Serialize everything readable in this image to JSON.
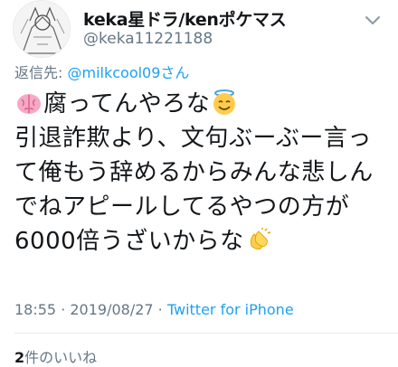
{
  "user": {
    "display_name": "keka星ドラ/kenポケマス",
    "handle": "@keka11221188"
  },
  "reply": {
    "prefix": "返信先: ",
    "target": "@milkcool09さん"
  },
  "tweet": {
    "line1_text": "腐ってんやろな",
    "line2": "引退詐欺より、文句ぶーぶー言っ",
    "line3": "て俺もう辞めるからみんな悲しん",
    "line4": "でねアピールしてるやつの方が",
    "line5_text": "6000倍うざいからな",
    "emojis": [
      "brain-emoji",
      "smiling-face-with-halo-emoji",
      "clapping-hands-emoji"
    ]
  },
  "meta": {
    "time": "18:55",
    "sep1": " · ",
    "date": "2019/08/27",
    "sep2": " · ",
    "source": "Twitter for iPhone"
  },
  "stats": {
    "likes_count": "2",
    "likes_label": "件のいいね"
  },
  "colors": {
    "link": "#1da1f2",
    "secondary": "#657786",
    "text": "#14171a",
    "divider": "#e6ecf0"
  }
}
